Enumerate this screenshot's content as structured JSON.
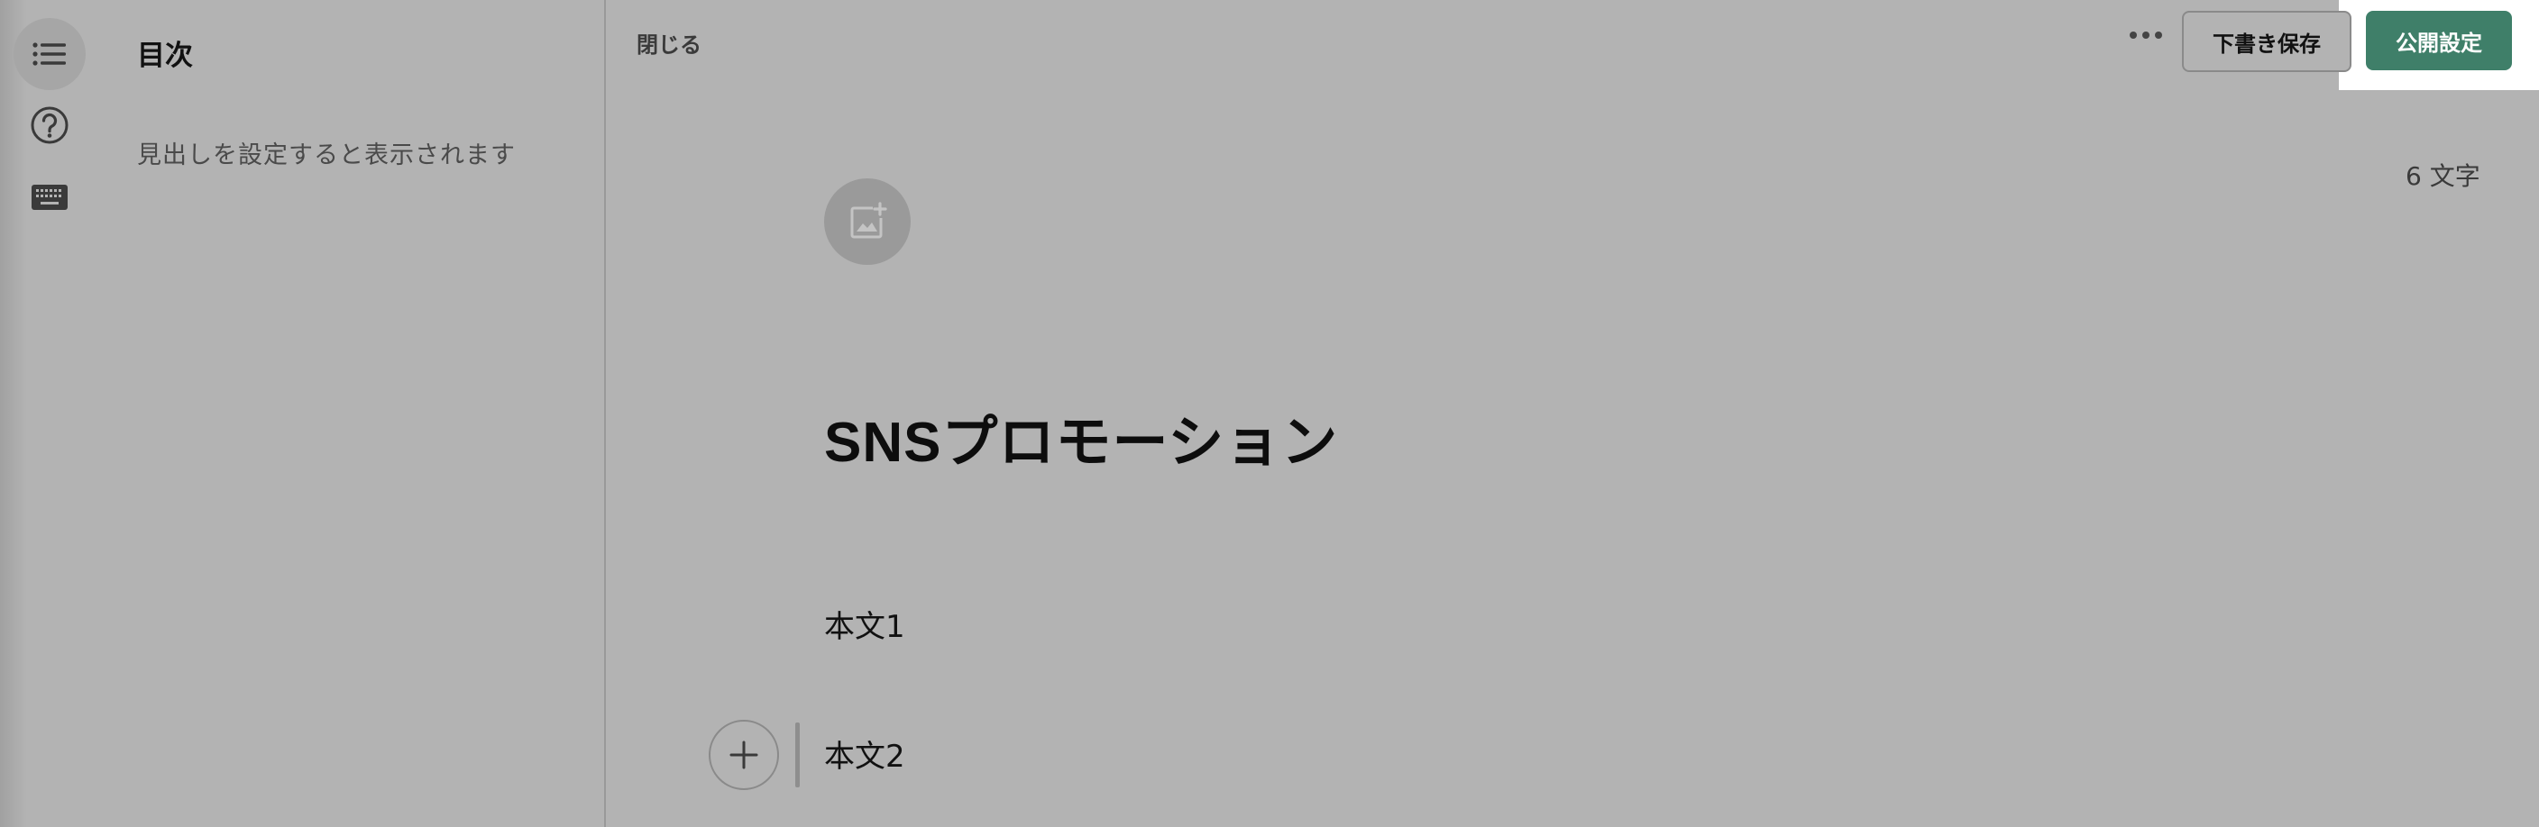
{
  "rail": {
    "icons": [
      "toc-list-icon",
      "help-icon",
      "keyboard-icon"
    ]
  },
  "toc": {
    "title": "目次",
    "empty_message": "見出しを設定すると表示されます"
  },
  "header": {
    "close_label": "閉じる",
    "draft_save_label": "下書き保存",
    "publish_settings_label": "公開設定",
    "more_icon": "ellipsis-icon"
  },
  "editor": {
    "char_count": "6 文字",
    "title": "SNSプロモーション",
    "paragraphs": [
      "本文1",
      "本文2"
    ],
    "image_add_icon": "image-add-icon",
    "add_block_icon": "plus-icon"
  },
  "colors": {
    "background_overlay": "#b3b3b3",
    "publish_button": "#3f7f69",
    "publish_text": "#ffffff"
  }
}
